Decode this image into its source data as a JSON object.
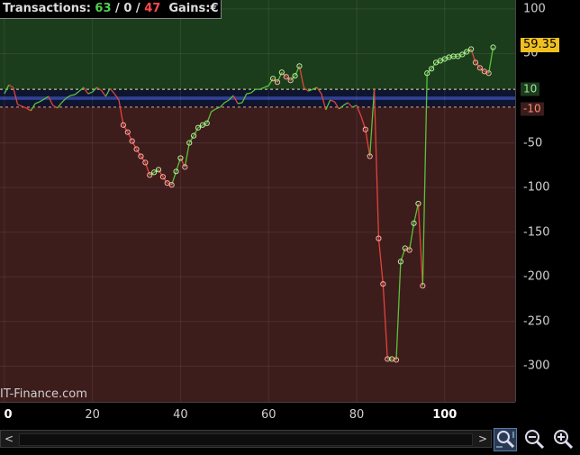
{
  "header": {
    "transactions_label": "Transactions:",
    "winning": "63",
    "separator1": "/",
    "neutral": "0",
    "separator2": "/",
    "losing": "47",
    "gains_label": "Gains:",
    "gains_currency": "€"
  },
  "watermark": "IT-Finance.com",
  "last_value": "59.35",
  "levels": {
    "upper": "10",
    "lower": "-10"
  },
  "y_ticks": [
    "100",
    "50",
    "-50",
    "-100",
    "-150",
    "-200",
    "-250",
    "-300"
  ],
  "x_ticks": [
    "0",
    "20",
    "40",
    "60",
    "80",
    "100"
  ],
  "scrollbar": {
    "left_arrow": "<",
    "right_arrow": ">"
  },
  "colors": {
    "gain_zone": "#1c3d1c",
    "loss_zone": "#3d1c1c",
    "rising": "#59c23a",
    "falling": "#e0453a",
    "level_band": "#0f1530",
    "last_value_box": "#f0c020"
  },
  "chart_data": {
    "type": "line",
    "xlim": [
      -1,
      116
    ],
    "ylim": [
      -340,
      110
    ],
    "upper_level": 10,
    "lower_level": -10,
    "x": [
      0,
      1,
      2,
      3,
      4,
      5,
      6,
      7,
      8,
      9,
      10,
      11,
      12,
      13,
      14,
      15,
      16,
      17,
      18,
      19,
      20,
      21,
      22,
      23,
      24,
      25,
      26,
      27,
      28,
      29,
      30,
      31,
      32,
      33,
      34,
      35,
      36,
      37,
      38,
      39,
      40,
      41,
      42,
      43,
      44,
      45,
      46,
      47,
      48,
      49,
      50,
      51,
      52,
      53,
      54,
      55,
      56,
      57,
      58,
      59,
      60,
      61,
      62,
      63,
      64,
      65,
      66,
      67,
      68,
      69,
      70,
      71,
      72,
      73,
      74,
      75,
      76,
      77,
      78,
      79,
      80,
      81,
      82,
      83,
      84,
      85,
      86,
      87,
      88,
      89,
      90,
      91,
      92,
      93,
      94,
      95,
      96,
      97,
      98,
      99,
      100,
      101,
      102,
      103,
      104,
      105,
      106,
      107,
      108,
      109,
      110,
      111
    ],
    "values": [
      5,
      15,
      12,
      -7,
      -9,
      -11,
      -14,
      -6,
      -4,
      -1,
      2,
      -8,
      -11,
      -5,
      0,
      3,
      4,
      8,
      12,
      5,
      7,
      12,
      9,
      2,
      11,
      5,
      -2,
      -30,
      -38,
      -48,
      -57,
      -65,
      -72,
      -86,
      -83,
      -80,
      -88,
      -95,
      -97,
      -82,
      -67,
      -77,
      -50,
      -42,
      -33,
      -30,
      -28,
      -15,
      -12,
      -10,
      -5,
      -2,
      3,
      -6,
      -5,
      5,
      6,
      10,
      10,
      12,
      14,
      22,
      18,
      29,
      24,
      20,
      25,
      36,
      12,
      8,
      10,
      12,
      5,
      -13,
      -2,
      -4,
      -12,
      -8,
      -5,
      -10,
      -8,
      -20,
      -35,
      -65,
      10,
      -157,
      -208,
      -292,
      -292,
      -293,
      -183,
      -168,
      -170,
      -140,
      -118,
      -210,
      28,
      33,
      40,
      42,
      44,
      46,
      47,
      47,
      49,
      52,
      55,
      40,
      34,
      30,
      28,
      57,
      59
    ]
  }
}
